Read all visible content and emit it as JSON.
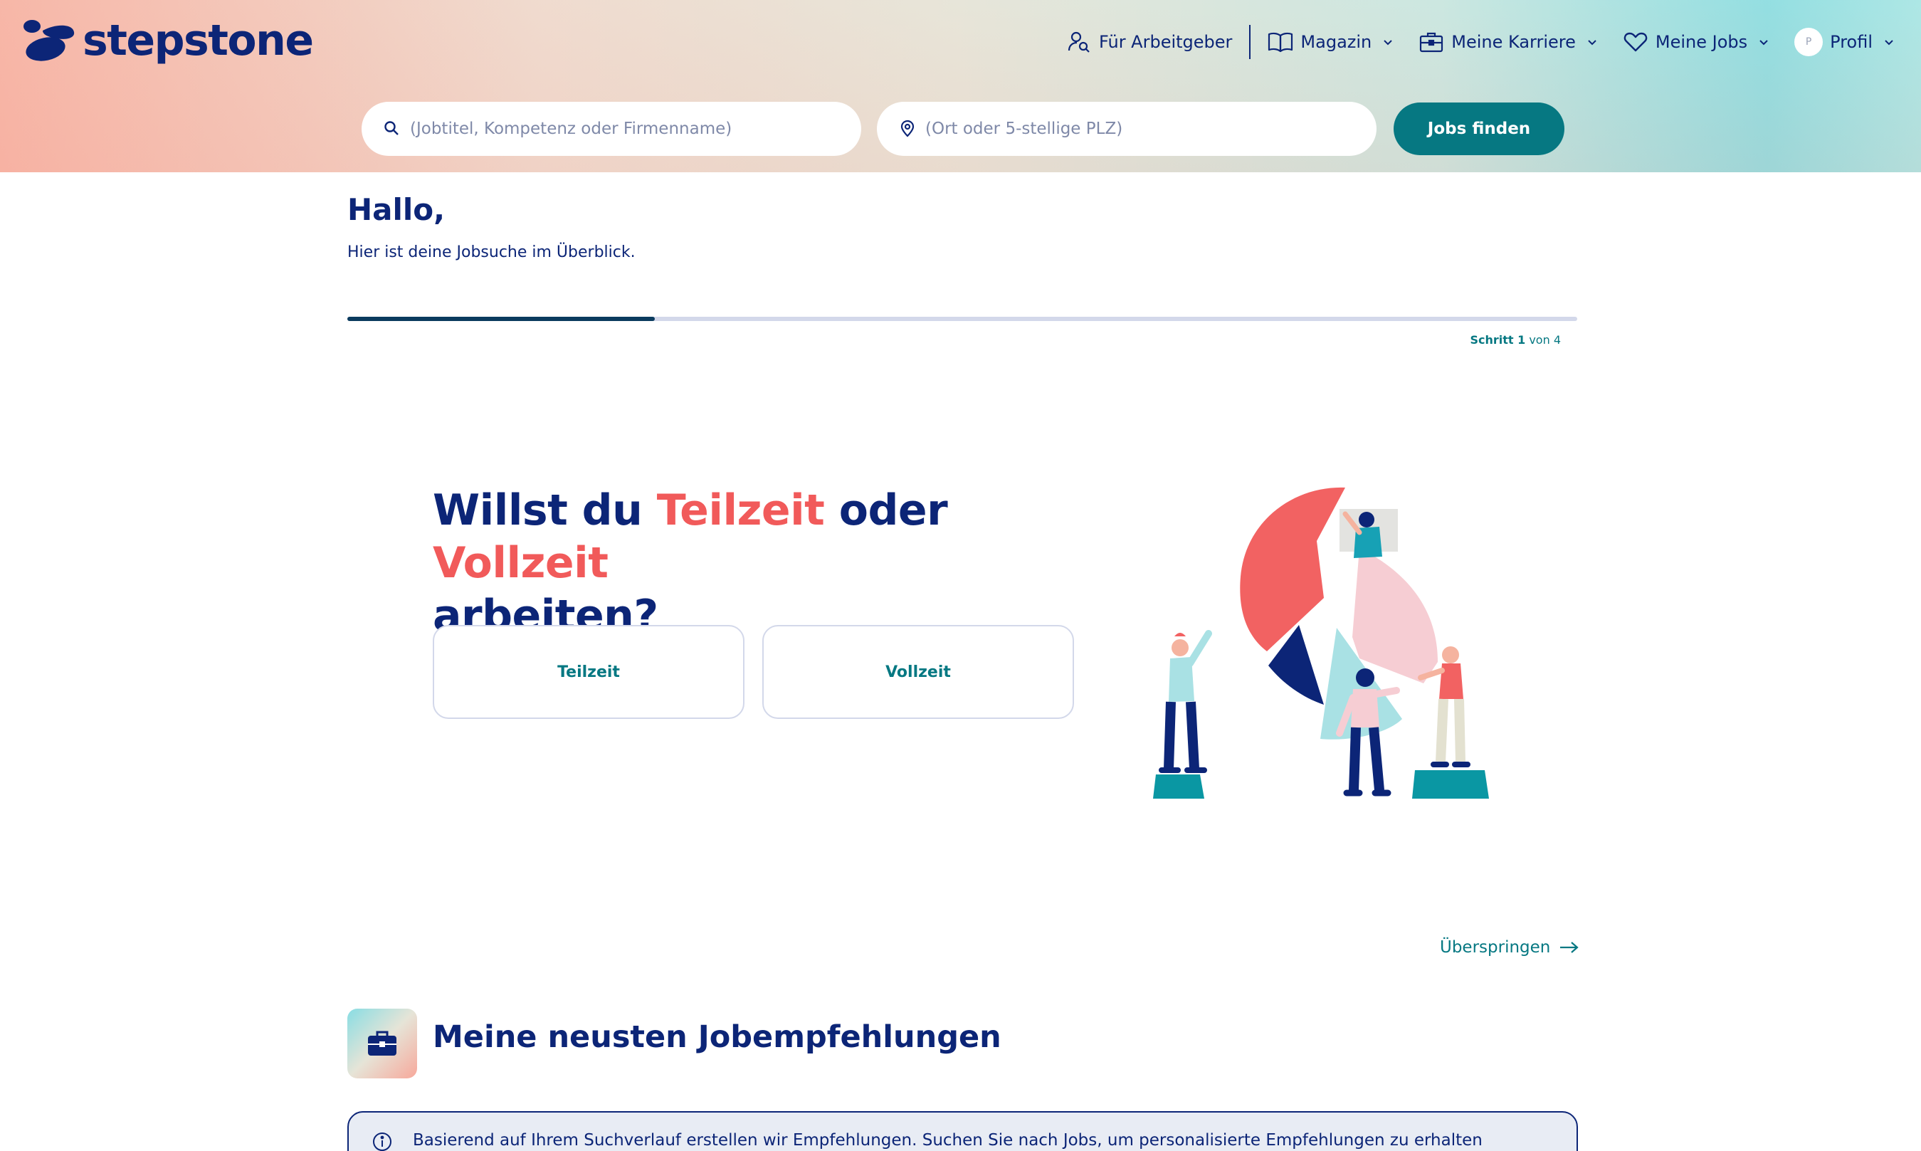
{
  "header": {
    "logo_text": "stepstone",
    "nav": {
      "employers": "Für Arbeitgeber",
      "magazine": "Magazin",
      "career": "Meine Karriere",
      "jobs": "Meine Jobs",
      "profile": "Profil",
      "avatar_initial": "P"
    },
    "search": {
      "what_placeholder": "(Jobtitel, Kompetenz oder Firmenname)",
      "where_placeholder": "(Ort oder 5-stellige PLZ)",
      "submit_label": "Jobs finden"
    }
  },
  "greeting": {
    "title": "Hallo,",
    "subtitle": "Hier ist deine Jobsuche im Überblick."
  },
  "progress": {
    "step_word": "Schritt 1",
    "of_text": "von 4",
    "fraction": 0.25
  },
  "question": {
    "part1": "Willst du ",
    "option1_word": "Teilzeit",
    "part2": " oder ",
    "option2_word": "Vollzeit",
    "part3": "arbeiten?",
    "choices": [
      "Teilzeit",
      "Vollzeit"
    ]
  },
  "skip_label": "Überspringen",
  "recommendations": {
    "title": "Meine neusten Jobempfehlungen",
    "info": "Basierend auf Ihrem Suchverlauf erstellen wir Empfehlungen. Suchen Sie nach Jobs, um personalisierte Empfehlungen zu erhalten"
  },
  "colors": {
    "brand_navy": "#0c2577",
    "teal": "#067882",
    "accent_red": "#f15a5a"
  },
  "icons": [
    "stepstone-logo-icon",
    "employer-search-icon",
    "book-icon",
    "briefcase-icon",
    "heart-icon",
    "chevron-down-icon",
    "search-icon",
    "location-pin-icon",
    "arrow-right-icon",
    "info-icon"
  ]
}
